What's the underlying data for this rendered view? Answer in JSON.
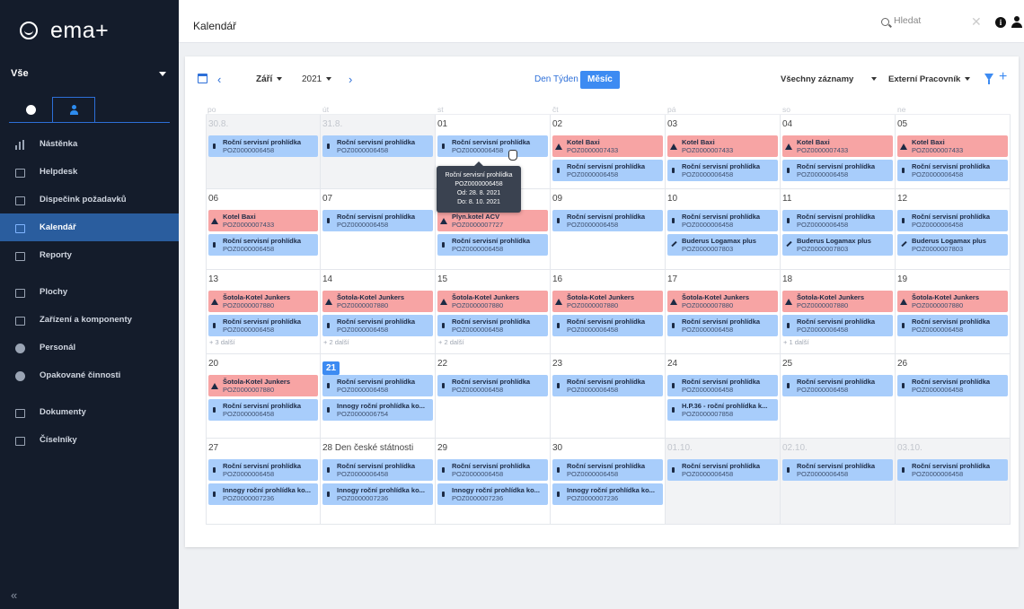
{
  "app": {
    "logo": "ema+",
    "scope": "Vše"
  },
  "header": {
    "title": "Kalendář",
    "search_placeholder": "Hledat"
  },
  "sidebar": {
    "items": [
      {
        "label": "Nástěnka",
        "icon": "chart-bars-icon",
        "active": false
      },
      {
        "label": "Helpdesk",
        "icon": "wrench-icon",
        "active": false
      },
      {
        "label": "Dispečink požadavků",
        "icon": "monitor-icon",
        "active": false
      },
      {
        "label": "Kalendář",
        "icon": "calendar-icon",
        "active": true
      },
      {
        "label": "Reporty",
        "icon": "report-icon",
        "active": false
      },
      {
        "label": "Plochy",
        "icon": "building-icon",
        "active": false
      },
      {
        "label": "Zařízení a komponenty",
        "icon": "devices-icon",
        "active": false
      },
      {
        "label": "Personál",
        "icon": "people-icon",
        "active": false
      },
      {
        "label": "Opakované činnosti",
        "icon": "repeat-icon",
        "active": false
      },
      {
        "label": "Dokumenty",
        "icon": "link-icon",
        "active": false
      },
      {
        "label": "Číselníky",
        "icon": "table-icon",
        "active": false
      }
    ],
    "collapse_label": "«"
  },
  "toolbar": {
    "month": "Září",
    "year": "2021",
    "views": {
      "day": "Den",
      "week": "Týden",
      "month": "Měsíc"
    },
    "filter": "Všechny záznamy",
    "worker": "Externí Pracovník",
    "add_label": "+"
  },
  "weekdays": [
    "po",
    "út",
    "st",
    "čt",
    "pá",
    "so",
    "ne"
  ],
  "weeks": [
    [
      {
        "num": "30.8.",
        "outside": true,
        "events": [
          {
            "t": "Roční servisní prohlídka",
            "c": "POZ0000006458",
            "k": "blue",
            "i": "wrench"
          }
        ]
      },
      {
        "num": "31.8.",
        "outside": true,
        "events": [
          {
            "t": "Roční servisní prohlídka",
            "c": "POZ0000006458",
            "k": "blue",
            "i": "wrench"
          }
        ]
      },
      {
        "num": "01",
        "events": [
          {
            "t": "Roční servisní prohlídka",
            "c": "POZ0000006458",
            "k": "blue",
            "i": "wrench"
          }
        ]
      },
      {
        "num": "02",
        "events": [
          {
            "t": "Kotel Baxi",
            "c": "POZ0000007433",
            "k": "red",
            "i": "warn"
          },
          {
            "t": "Roční servisní prohlídka",
            "c": "POZ0000006458",
            "k": "blue",
            "i": "wrench"
          }
        ]
      },
      {
        "num": "03",
        "events": [
          {
            "t": "Kotel Baxi",
            "c": "POZ0000007433",
            "k": "red",
            "i": "warn"
          },
          {
            "t": "Roční servisní prohlídka",
            "c": "POZ0000006458",
            "k": "blue",
            "i": "wrench"
          }
        ]
      },
      {
        "num": "04",
        "events": [
          {
            "t": "Kotel Baxi",
            "c": "POZ0000007433",
            "k": "red",
            "i": "warn"
          },
          {
            "t": "Roční servisní prohlídka",
            "c": "POZ0000006458",
            "k": "blue",
            "i": "wrench"
          }
        ]
      },
      {
        "num": "05",
        "events": [
          {
            "t": "Kotel Baxi",
            "c": "POZ0000007433",
            "k": "red",
            "i": "warn"
          },
          {
            "t": "Roční servisní prohlídka",
            "c": "POZ0000006458",
            "k": "blue",
            "i": "wrench"
          }
        ]
      }
    ],
    [
      {
        "num": "06",
        "events": [
          {
            "t": "Kotel Baxi",
            "c": "POZ0000007433",
            "k": "red",
            "i": "warn"
          },
          {
            "t": "Roční servisní prohlídka",
            "c": "POZ0000006458",
            "k": "blue",
            "i": "wrench"
          }
        ]
      },
      {
        "num": "07",
        "events": [
          {
            "t": "Roční servisní prohlídka",
            "c": "POZ0000006458",
            "k": "blue",
            "i": "wrench"
          }
        ]
      },
      {
        "num": "08",
        "events": [
          {
            "t": "Plyn.kotel ACV",
            "c": "POZ0000007727",
            "k": "red",
            "i": "warn"
          },
          {
            "t": "Roční servisní prohlídka",
            "c": "POZ0000006458",
            "k": "blue",
            "i": "wrench"
          }
        ]
      },
      {
        "num": "09",
        "events": [
          {
            "t": "Roční servisní prohlídka",
            "c": "POZ0000006458",
            "k": "blue",
            "i": "wrench"
          }
        ]
      },
      {
        "num": "10",
        "events": [
          {
            "t": "Roční servisní prohlídka",
            "c": "POZ0000006458",
            "k": "blue",
            "i": "wrench"
          },
          {
            "t": "Buderus Logamax plus",
            "c": "POZ0000007803",
            "k": "blue",
            "i": "tool"
          }
        ]
      },
      {
        "num": "11",
        "events": [
          {
            "t": "Roční servisní prohlídka",
            "c": "POZ0000006458",
            "k": "blue",
            "i": "wrench"
          },
          {
            "t": "Buderus Logamax plus",
            "c": "POZ0000007803",
            "k": "blue",
            "i": "tool"
          }
        ]
      },
      {
        "num": "12",
        "events": [
          {
            "t": "Roční servisní prohlídka",
            "c": "POZ0000006458",
            "k": "blue",
            "i": "wrench"
          },
          {
            "t": "Buderus Logamax plus",
            "c": "POZ0000007803",
            "k": "blue",
            "i": "tool"
          }
        ]
      }
    ],
    [
      {
        "num": "13",
        "more": "+ 3 další",
        "events": [
          {
            "t": "Šotola-Kotel Junkers",
            "c": "POZ0000007880",
            "k": "red",
            "i": "warn"
          },
          {
            "t": "Roční servisní prohlídka",
            "c": "POZ0000006458",
            "k": "blue",
            "i": "wrench"
          }
        ]
      },
      {
        "num": "14",
        "more": "+ 2 další",
        "events": [
          {
            "t": "Šotola-Kotel Junkers",
            "c": "POZ0000007880",
            "k": "red",
            "i": "warn"
          },
          {
            "t": "Roční servisní prohlídka",
            "c": "POZ0000006458",
            "k": "blue",
            "i": "wrench"
          }
        ]
      },
      {
        "num": "15",
        "more": "+ 2 další",
        "events": [
          {
            "t": "Šotola-Kotel Junkers",
            "c": "POZ0000007880",
            "k": "red",
            "i": "warn"
          },
          {
            "t": "Roční servisní prohlídka",
            "c": "POZ0000006458",
            "k": "blue",
            "i": "wrench"
          }
        ]
      },
      {
        "num": "16",
        "events": [
          {
            "t": "Šotola-Kotel Junkers",
            "c": "POZ0000007880",
            "k": "red",
            "i": "warn"
          },
          {
            "t": "Roční servisní prohlídka",
            "c": "POZ0000006458",
            "k": "blue",
            "i": "wrench"
          }
        ]
      },
      {
        "num": "17",
        "events": [
          {
            "t": "Šotola-Kotel Junkers",
            "c": "POZ0000007880",
            "k": "red",
            "i": "warn"
          },
          {
            "t": "Roční servisní prohlídka",
            "c": "POZ0000006458",
            "k": "blue",
            "i": "wrench"
          }
        ]
      },
      {
        "num": "18",
        "more": "+ 1 další",
        "events": [
          {
            "t": "Šotola-Kotel Junkers",
            "c": "POZ0000007880",
            "k": "red",
            "i": "warn"
          },
          {
            "t": "Roční servisní prohlídka",
            "c": "POZ0000006458",
            "k": "blue",
            "i": "wrench"
          }
        ]
      },
      {
        "num": "19",
        "events": [
          {
            "t": "Šotola-Kotel Junkers",
            "c": "POZ0000007880",
            "k": "red",
            "i": "warn"
          },
          {
            "t": "Roční servisní prohlídka",
            "c": "POZ0000006458",
            "k": "blue",
            "i": "wrench"
          }
        ]
      }
    ],
    [
      {
        "num": "20",
        "events": [
          {
            "t": "Šotola-Kotel Junkers",
            "c": "POZ0000007880",
            "k": "red",
            "i": "warn"
          },
          {
            "t": "Roční servisní prohlídka",
            "c": "POZ0000006458",
            "k": "blue",
            "i": "wrench"
          }
        ]
      },
      {
        "num": "21",
        "today": true,
        "events": [
          {
            "t": "Roční servisní prohlídka",
            "c": "POZ0000006458",
            "k": "blue",
            "i": "wrench"
          },
          {
            "t": "Innogy roční prohlídka ko...",
            "c": "POZ0000006754",
            "k": "blue",
            "i": "wrench"
          }
        ]
      },
      {
        "num": "22",
        "events": [
          {
            "t": "Roční servisní prohlídka",
            "c": "POZ0000006458",
            "k": "blue",
            "i": "wrench"
          }
        ]
      },
      {
        "num": "23",
        "events": [
          {
            "t": "Roční servisní prohlídka",
            "c": "POZ0000006458",
            "k": "blue",
            "i": "wrench"
          }
        ]
      },
      {
        "num": "24",
        "events": [
          {
            "t": "Roční servisní prohlídka",
            "c": "POZ0000006458",
            "k": "blue",
            "i": "wrench"
          },
          {
            "t": "H.P.36 - roční prohlídka k...",
            "c": "POZ0000007858",
            "k": "blue",
            "i": "wrench"
          }
        ]
      },
      {
        "num": "25",
        "events": [
          {
            "t": "Roční servisní prohlídka",
            "c": "POZ0000006458",
            "k": "blue",
            "i": "wrench"
          }
        ]
      },
      {
        "num": "26",
        "events": [
          {
            "t": "Roční servisní prohlídka",
            "c": "POZ0000006458",
            "k": "blue",
            "i": "wrench"
          }
        ]
      }
    ],
    [
      {
        "num": "27",
        "events": [
          {
            "t": "Roční servisní prohlídka",
            "c": "POZ0000006458",
            "k": "blue",
            "i": "wrench"
          },
          {
            "t": "Innogy roční prohlídka ko...",
            "c": "POZ0000007236",
            "k": "blue",
            "i": "wrench"
          }
        ]
      },
      {
        "num": "28 Den české státnosti",
        "events": [
          {
            "t": "Roční servisní prohlídka",
            "c": "POZ0000006458",
            "k": "blue",
            "i": "wrench"
          },
          {
            "t": "Innogy roční prohlídka ko...",
            "c": "POZ0000007236",
            "k": "blue",
            "i": "wrench"
          }
        ]
      },
      {
        "num": "29",
        "events": [
          {
            "t": "Roční servisní prohlídka",
            "c": "POZ0000006458",
            "k": "blue",
            "i": "wrench"
          },
          {
            "t": "Innogy roční prohlídka ko...",
            "c": "POZ0000007236",
            "k": "blue",
            "i": "wrench"
          }
        ]
      },
      {
        "num": "30",
        "events": [
          {
            "t": "Roční servisní prohlídka",
            "c": "POZ0000006458",
            "k": "blue",
            "i": "wrench"
          },
          {
            "t": "Innogy roční prohlídka ko...",
            "c": "POZ0000007236",
            "k": "blue",
            "i": "wrench"
          }
        ]
      },
      {
        "num": "01.10.",
        "outside": true,
        "events": [
          {
            "t": "Roční servisní prohlídka",
            "c": "POZ0000006458",
            "k": "blue",
            "i": "wrench"
          }
        ]
      },
      {
        "num": "02.10.",
        "outside": true,
        "events": [
          {
            "t": "Roční servisní prohlídka",
            "c": "POZ0000006458",
            "k": "blue",
            "i": "wrench"
          }
        ]
      },
      {
        "num": "03.10.",
        "outside": true,
        "events": [
          {
            "t": "Roční servisní prohlídka",
            "c": "POZ0000006458",
            "k": "blue",
            "i": "wrench"
          }
        ]
      }
    ]
  ],
  "tooltip": {
    "title": "Roční servisní prohlídka",
    "code": "POZ0000006458",
    "from": "Od: 28. 8. 2021",
    "to": "Do: 8. 10. 2021"
  },
  "colors": {
    "accent": "#3d8bf2",
    "event_blue": "#a8cdfb",
    "event_red": "#f7a4a4",
    "sidebar_bg": "#141c2b",
    "sidebar_active": "#2a5d9e"
  }
}
